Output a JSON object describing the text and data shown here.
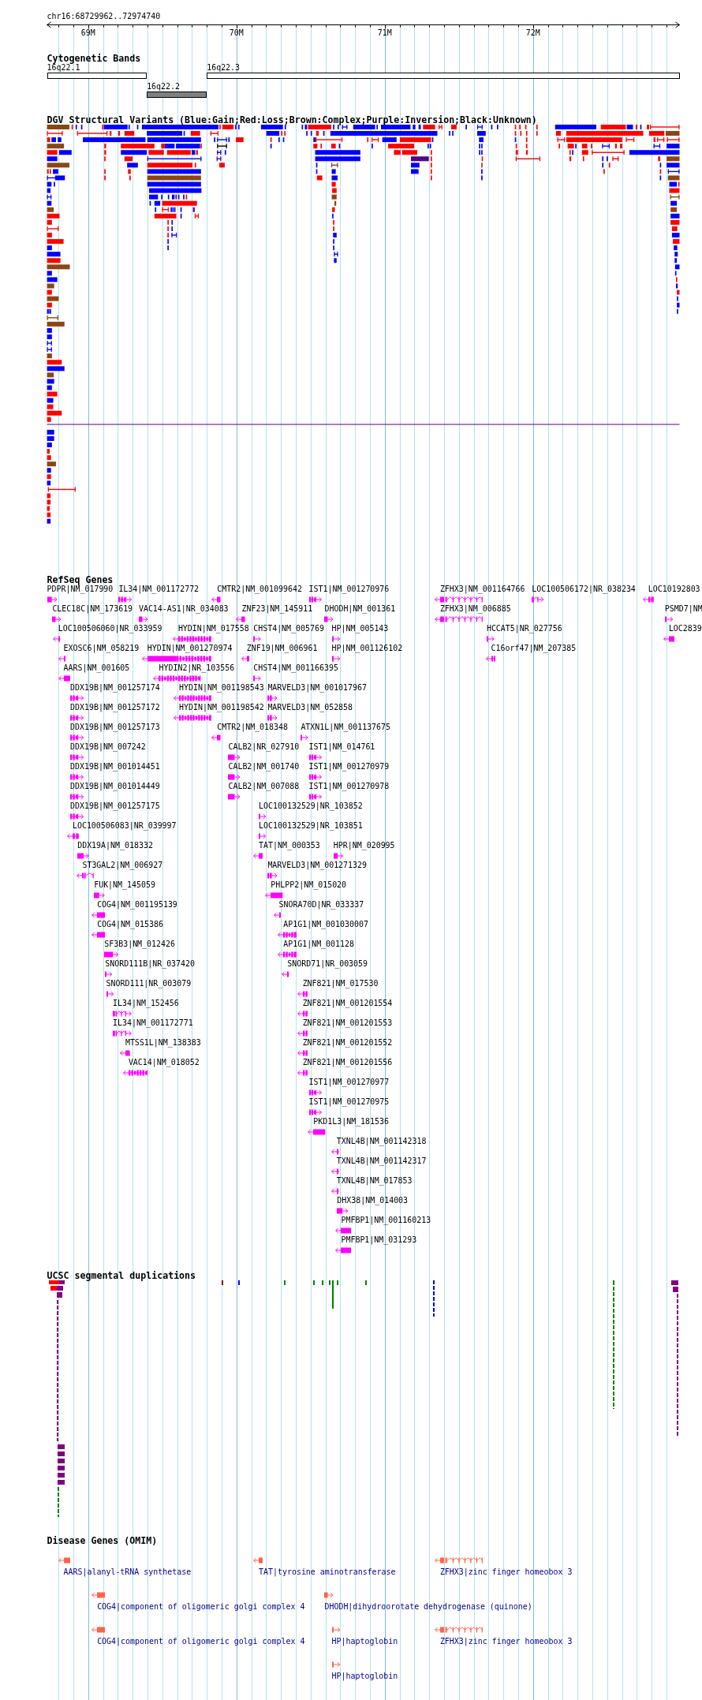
{
  "ruler": {
    "range": "chr16:68729962..72974740",
    "ticks": [
      "69M",
      "70M",
      "71M",
      "72M"
    ]
  },
  "cytogenetic_bands": {
    "title": "Cytogenetic Bands",
    "bands": [
      {
        "label": "16q22.1",
        "shaded": false
      },
      {
        "label": "16q22.2",
        "shaded": true
      },
      {
        "label": "16q22.3",
        "shaded": false
      }
    ]
  },
  "dgv_structural_variants": {
    "title": "DGV Structural Variants (Blue:Gain;Red:Loss;Brown:Complex;Purple:Inversion;Black:Unknown)"
  },
  "refseq_genes": {
    "title": "RefSeq Genes",
    "features": [
      {
        "label": "PDPR|NM_017990",
        "reverse": false
      },
      {
        "label": "IL34|NM_001172772",
        "reverse": false
      },
      {
        "label": "CMTR2|NM_001099642",
        "reverse": true
      },
      {
        "label": "IST1|NM_001270976",
        "reverse": false
      },
      {
        "label": "ZFHX3|NM_001164766",
        "reverse": true
      },
      {
        "label": "LOC100506172|NR_038234",
        "reverse": false
      },
      {
        "label": "LOC10192803",
        "reverse": true
      },
      {
        "label": "CLEC18C|NM_173619",
        "reverse": false
      },
      {
        "label": "VAC14-AS1|NR_034083",
        "reverse": false
      },
      {
        "label": "ZNF23|NM_145911",
        "reverse": true
      },
      {
        "label": "DHODH|NM_001361",
        "reverse": false
      },
      {
        "label": "ZFHX3|NM_006885",
        "reverse": true
      },
      {
        "label": "PSMD7|NM",
        "reverse": false
      },
      {
        "label": "LOC100506060|NR_033959",
        "reverse": true
      },
      {
        "label": "HYDIN|NM_017558",
        "reverse": true
      },
      {
        "label": "CHST4|NM_005769",
        "reverse": false
      },
      {
        "label": "HP|NM_005143",
        "reverse": false
      },
      {
        "label": "HCCAT5|NR_027756",
        "reverse": false
      },
      {
        "label": "LOC2839",
        "reverse": true
      },
      {
        "label": "EXOSC6|NM_058219",
        "reverse": true
      },
      {
        "label": "HYDIN|NM_001270974",
        "reverse": true
      },
      {
        "label": "ZNF19|NM_006961",
        "reverse": true
      },
      {
        "label": "HP|NM_001126102",
        "reverse": false
      },
      {
        "label": "C16orf47|NM_207385",
        "reverse": true
      },
      {
        "label": "AARS|NM_001605",
        "reverse": true
      },
      {
        "label": "HYDIN2|NR_103556",
        "reverse": true
      },
      {
        "label": "CHST4|NM_001166395",
        "reverse": false
      },
      {
        "label": "DDX19B|NM_001257174",
        "reverse": false
      },
      {
        "label": "HYDIN|NM_001198543",
        "reverse": true
      },
      {
        "label": "MARVELD3|NM_001017967",
        "reverse": false
      },
      {
        "label": "DDX19B|NM_001257172",
        "reverse": false
      },
      {
        "label": "HYDIN|NM_001198542",
        "reverse": true
      },
      {
        "label": "MARVELD3|NM_052858",
        "reverse": false
      },
      {
        "label": "DDX19B|NM_001257173",
        "reverse": false
      },
      {
        "label": "CMTR2|NM_018348",
        "reverse": true
      },
      {
        "label": "ATXN1L|NM_001137675",
        "reverse": false
      },
      {
        "label": "DDX19B|NM_007242",
        "reverse": false
      },
      {
        "label": "CALB2|NR_027910",
        "reverse": false
      },
      {
        "label": "IST1|NM_014761",
        "reverse": false
      },
      {
        "label": "DDX19B|NM_001014451",
        "reverse": false
      },
      {
        "label": "CALB2|NM_001740",
        "reverse": false
      },
      {
        "label": "IST1|NM_001270979",
        "reverse": false
      },
      {
        "label": "DDX19B|NM_001014449",
        "reverse": false
      },
      {
        "label": "CALB2|NM_007088",
        "reverse": false
      },
      {
        "label": "IST1|NM_001270978",
        "reverse": false
      },
      {
        "label": "DDX19B|NM_001257175",
        "reverse": false
      },
      {
        "label": "LOC100132529|NR_103852",
        "reverse": false
      },
      {
        "label": "LOC100506083|NR_039997",
        "reverse": true
      },
      {
        "label": "LOC100132529|NR_103851",
        "reverse": false
      },
      {
        "label": "DDX19A|NM_018332",
        "reverse": false
      },
      {
        "label": "TAT|NM_000353",
        "reverse": true
      },
      {
        "label": "HPR|NM_020995",
        "reverse": false
      },
      {
        "label": "ST3GAL2|NM_006927",
        "reverse": true
      },
      {
        "label": "MARVELD3|NM_001271329",
        "reverse": false
      },
      {
        "label": "FUK|NM_145059",
        "reverse": false
      },
      {
        "label": "PHLPP2|NM_015020",
        "reverse": true
      },
      {
        "label": "COG4|NM_001195139",
        "reverse": true
      },
      {
        "label": "SNORA70D|NR_033337",
        "reverse": true
      },
      {
        "label": "COG4|NM_015386",
        "reverse": true
      },
      {
        "label": "AP1G1|NM_001030007",
        "reverse": true
      },
      {
        "label": "SF3B3|NM_012426",
        "reverse": false
      },
      {
        "label": "AP1G1|NM_001128",
        "reverse": true
      },
      {
        "label": "SNORD111B|NR_037420",
        "reverse": false
      },
      {
        "label": "SNORD71|NR_003059",
        "reverse": true
      },
      {
        "label": "SNORD111|NR_003079",
        "reverse": false
      },
      {
        "label": "ZNF821|NM_017530",
        "reverse": true
      },
      {
        "label": "IL34|NM_152456",
        "reverse": false
      },
      {
        "label": "ZNF821|NM_001201554",
        "reverse": true
      },
      {
        "label": "IL34|NM_001172771",
        "reverse": false
      },
      {
        "label": "ZNF821|NM_001201553",
        "reverse": true
      },
      {
        "label": "MTSS1L|NM_138383",
        "reverse": true
      },
      {
        "label": "ZNF821|NM_001201552",
        "reverse": true
      },
      {
        "label": "VAC14|NM_018052",
        "reverse": true
      },
      {
        "label": "ZNF821|NM_001201556",
        "reverse": true
      },
      {
        "label": "IST1|NM_001270977",
        "reverse": false
      },
      {
        "label": "IST1|NM_001270975",
        "reverse": false
      },
      {
        "label": "PKD1L3|NM_181536",
        "reverse": true
      },
      {
        "label": "TXNL4B|NM_001142318",
        "reverse": true
      },
      {
        "label": "TXNL4B|NM_001142317",
        "reverse": true
      },
      {
        "label": "TXNL4B|NM_017853",
        "reverse": true
      },
      {
        "label": "DHX38|NM_014003",
        "reverse": false
      },
      {
        "label": "PMFBP1|NM_001160213",
        "reverse": true
      },
      {
        "label": "PMFBP1|NM_031293",
        "reverse": true
      }
    ]
  },
  "segmental_duplications": {
    "title": "UCSC segmental duplications"
  },
  "disease_genes": {
    "title": "Disease Genes (OMIM)",
    "features": [
      {
        "label": "AARS|alanyl-tRNA synthetase",
        "reverse": true
      },
      {
        "label": "TAT|tyrosine aminotransferase",
        "reverse": true
      },
      {
        "label": "ZFHX3|zinc finger homeobox 3",
        "reverse": true
      },
      {
        "label": "COG4|component of oligomeric golgi complex 4",
        "reverse": true
      },
      {
        "label": "DHODH|dihydroorotate dehydrogenase (quinone)",
        "reverse": false
      },
      {
        "label": "COG4|component of oligomeric golgi complex 4",
        "reverse": true
      },
      {
        "label": "HP|haptoglobin",
        "reverse": false
      },
      {
        "label": "ZFHX3|zinc finger homeobox 3",
        "reverse": true
      },
      {
        "label": "HP|haptoglobin",
        "reverse": false
      }
    ]
  }
}
